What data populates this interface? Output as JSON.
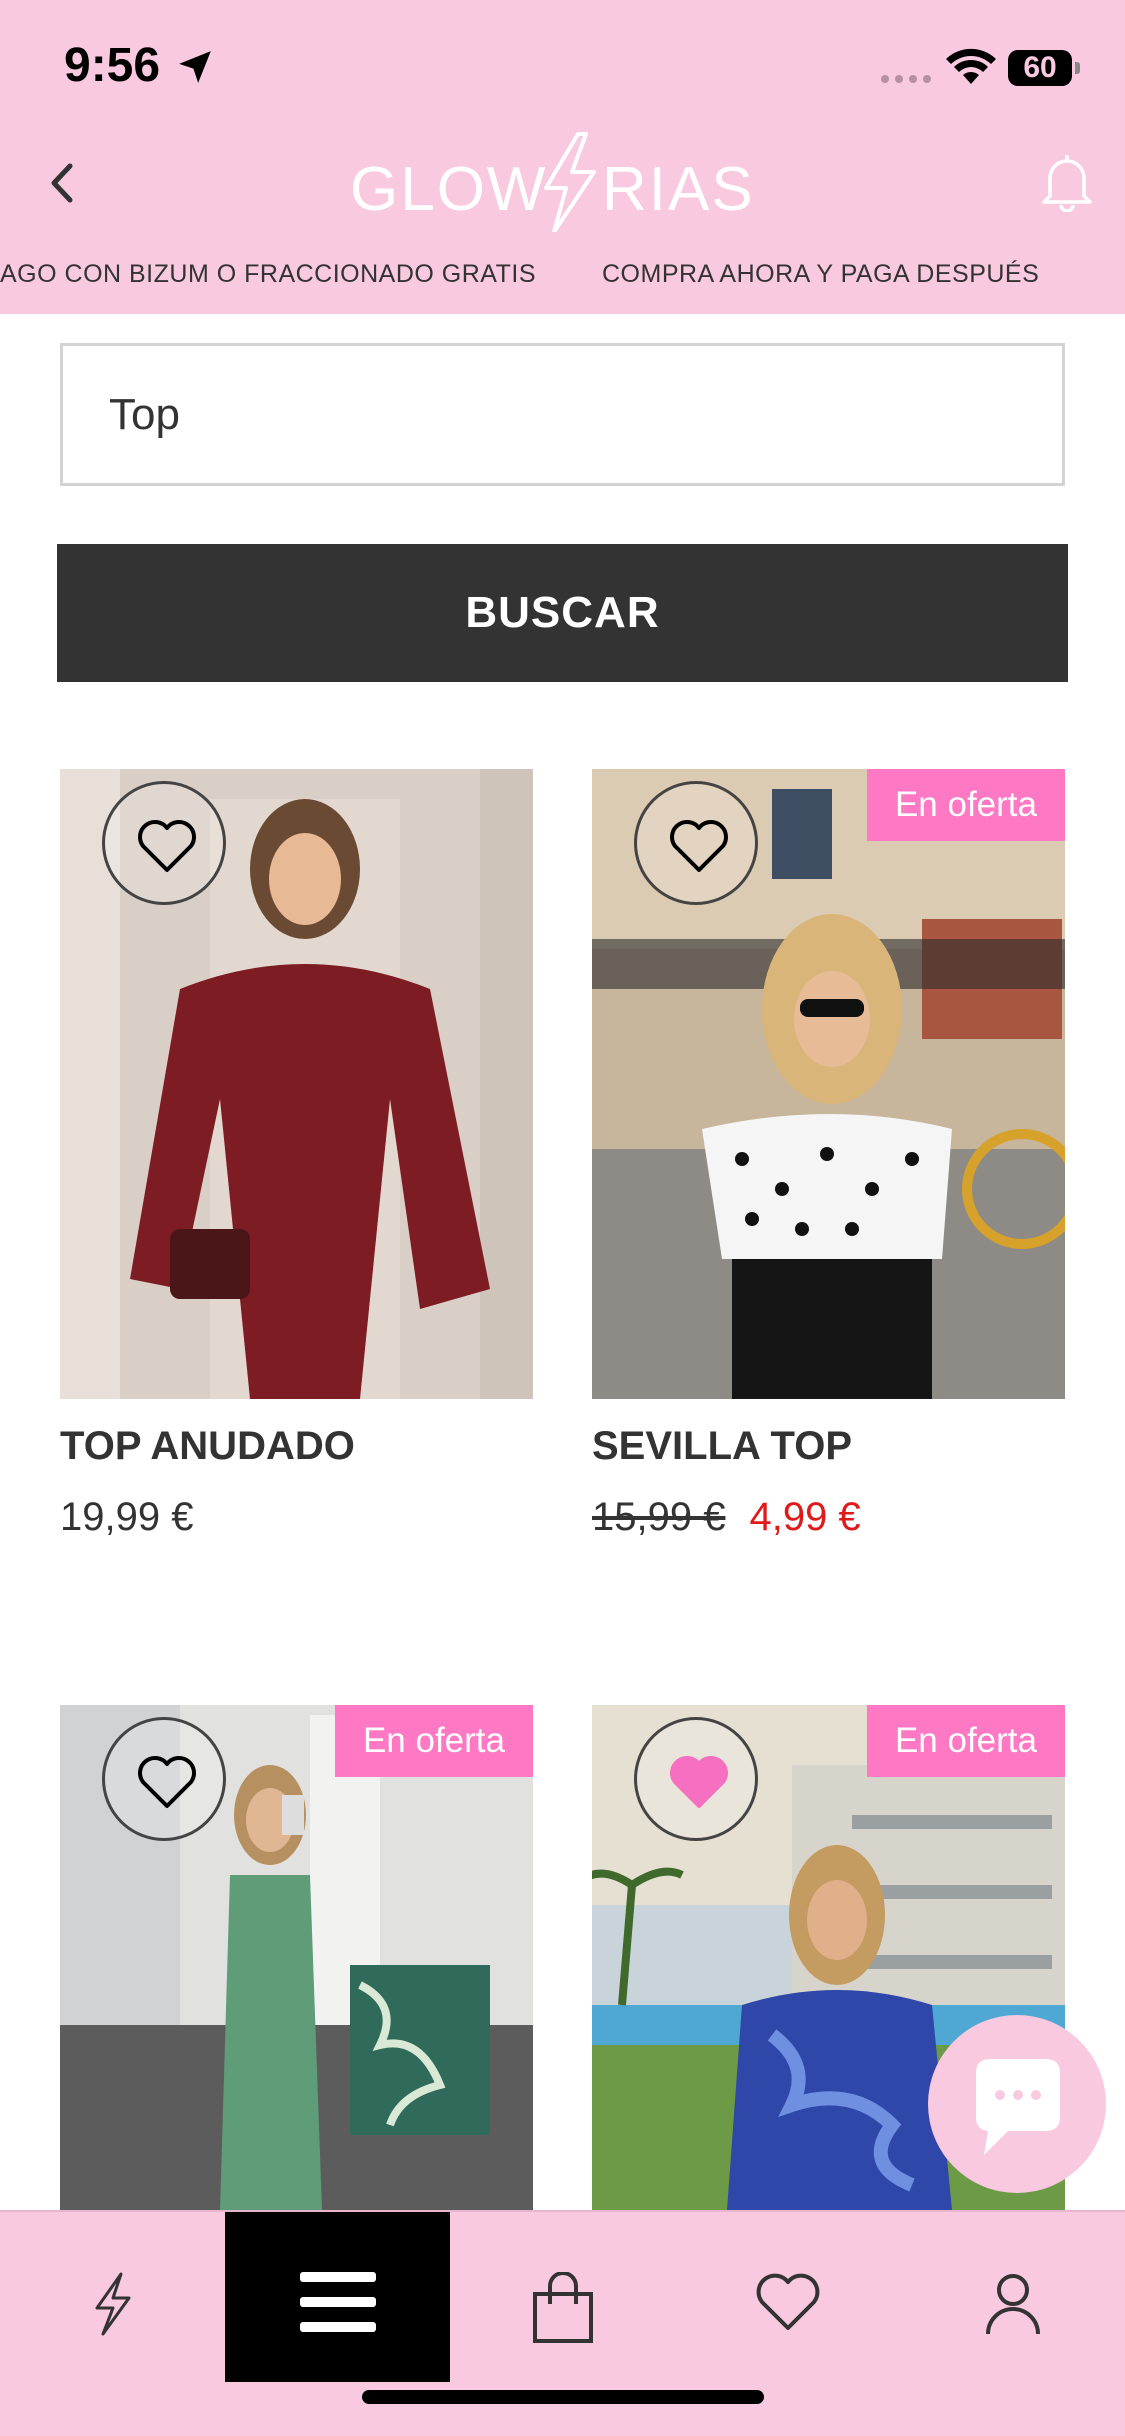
{
  "status_bar": {
    "time": "9:56",
    "battery": "60",
    "icons": [
      "location-arrow-icon",
      "signal-icon",
      "wifi-icon",
      "battery-icon"
    ]
  },
  "header": {
    "logo_text": "GLOWRIAS",
    "back_icon": "chevron-left-icon",
    "bell_icon": "bell-icon",
    "promo_left": "AGO CON BIZUM O FRACCIONADO GRATIS",
    "promo_right": "COMPRA AHORA Y PAGA DESPUÉS"
  },
  "search": {
    "value": "Top",
    "button_label": "BUSCAR"
  },
  "products": [
    {
      "name": "TOP ANUDADO",
      "price": "19,99 €",
      "old_price": "",
      "badge": "",
      "favorited": false
    },
    {
      "name": "SEVILLA TOP",
      "price": "4,99 €",
      "old_price": "15,99 €",
      "badge": "En oferta",
      "favorited": false
    },
    {
      "name": "",
      "price": "",
      "old_price": "",
      "badge": "En oferta",
      "favorited": false
    },
    {
      "name": "",
      "price": "",
      "old_price": "",
      "badge": "En oferta",
      "favorited": true
    }
  ],
  "tabbar": {
    "tabs": [
      "bolt-icon",
      "menu-icon",
      "bag-icon",
      "heart-icon",
      "user-icon"
    ],
    "active": "menu-icon"
  },
  "colors": {
    "brand_pink": "#f8c9df",
    "badge_pink": "#ff78c4",
    "sale_red": "#e01a1a",
    "button_dark": "#333333"
  }
}
